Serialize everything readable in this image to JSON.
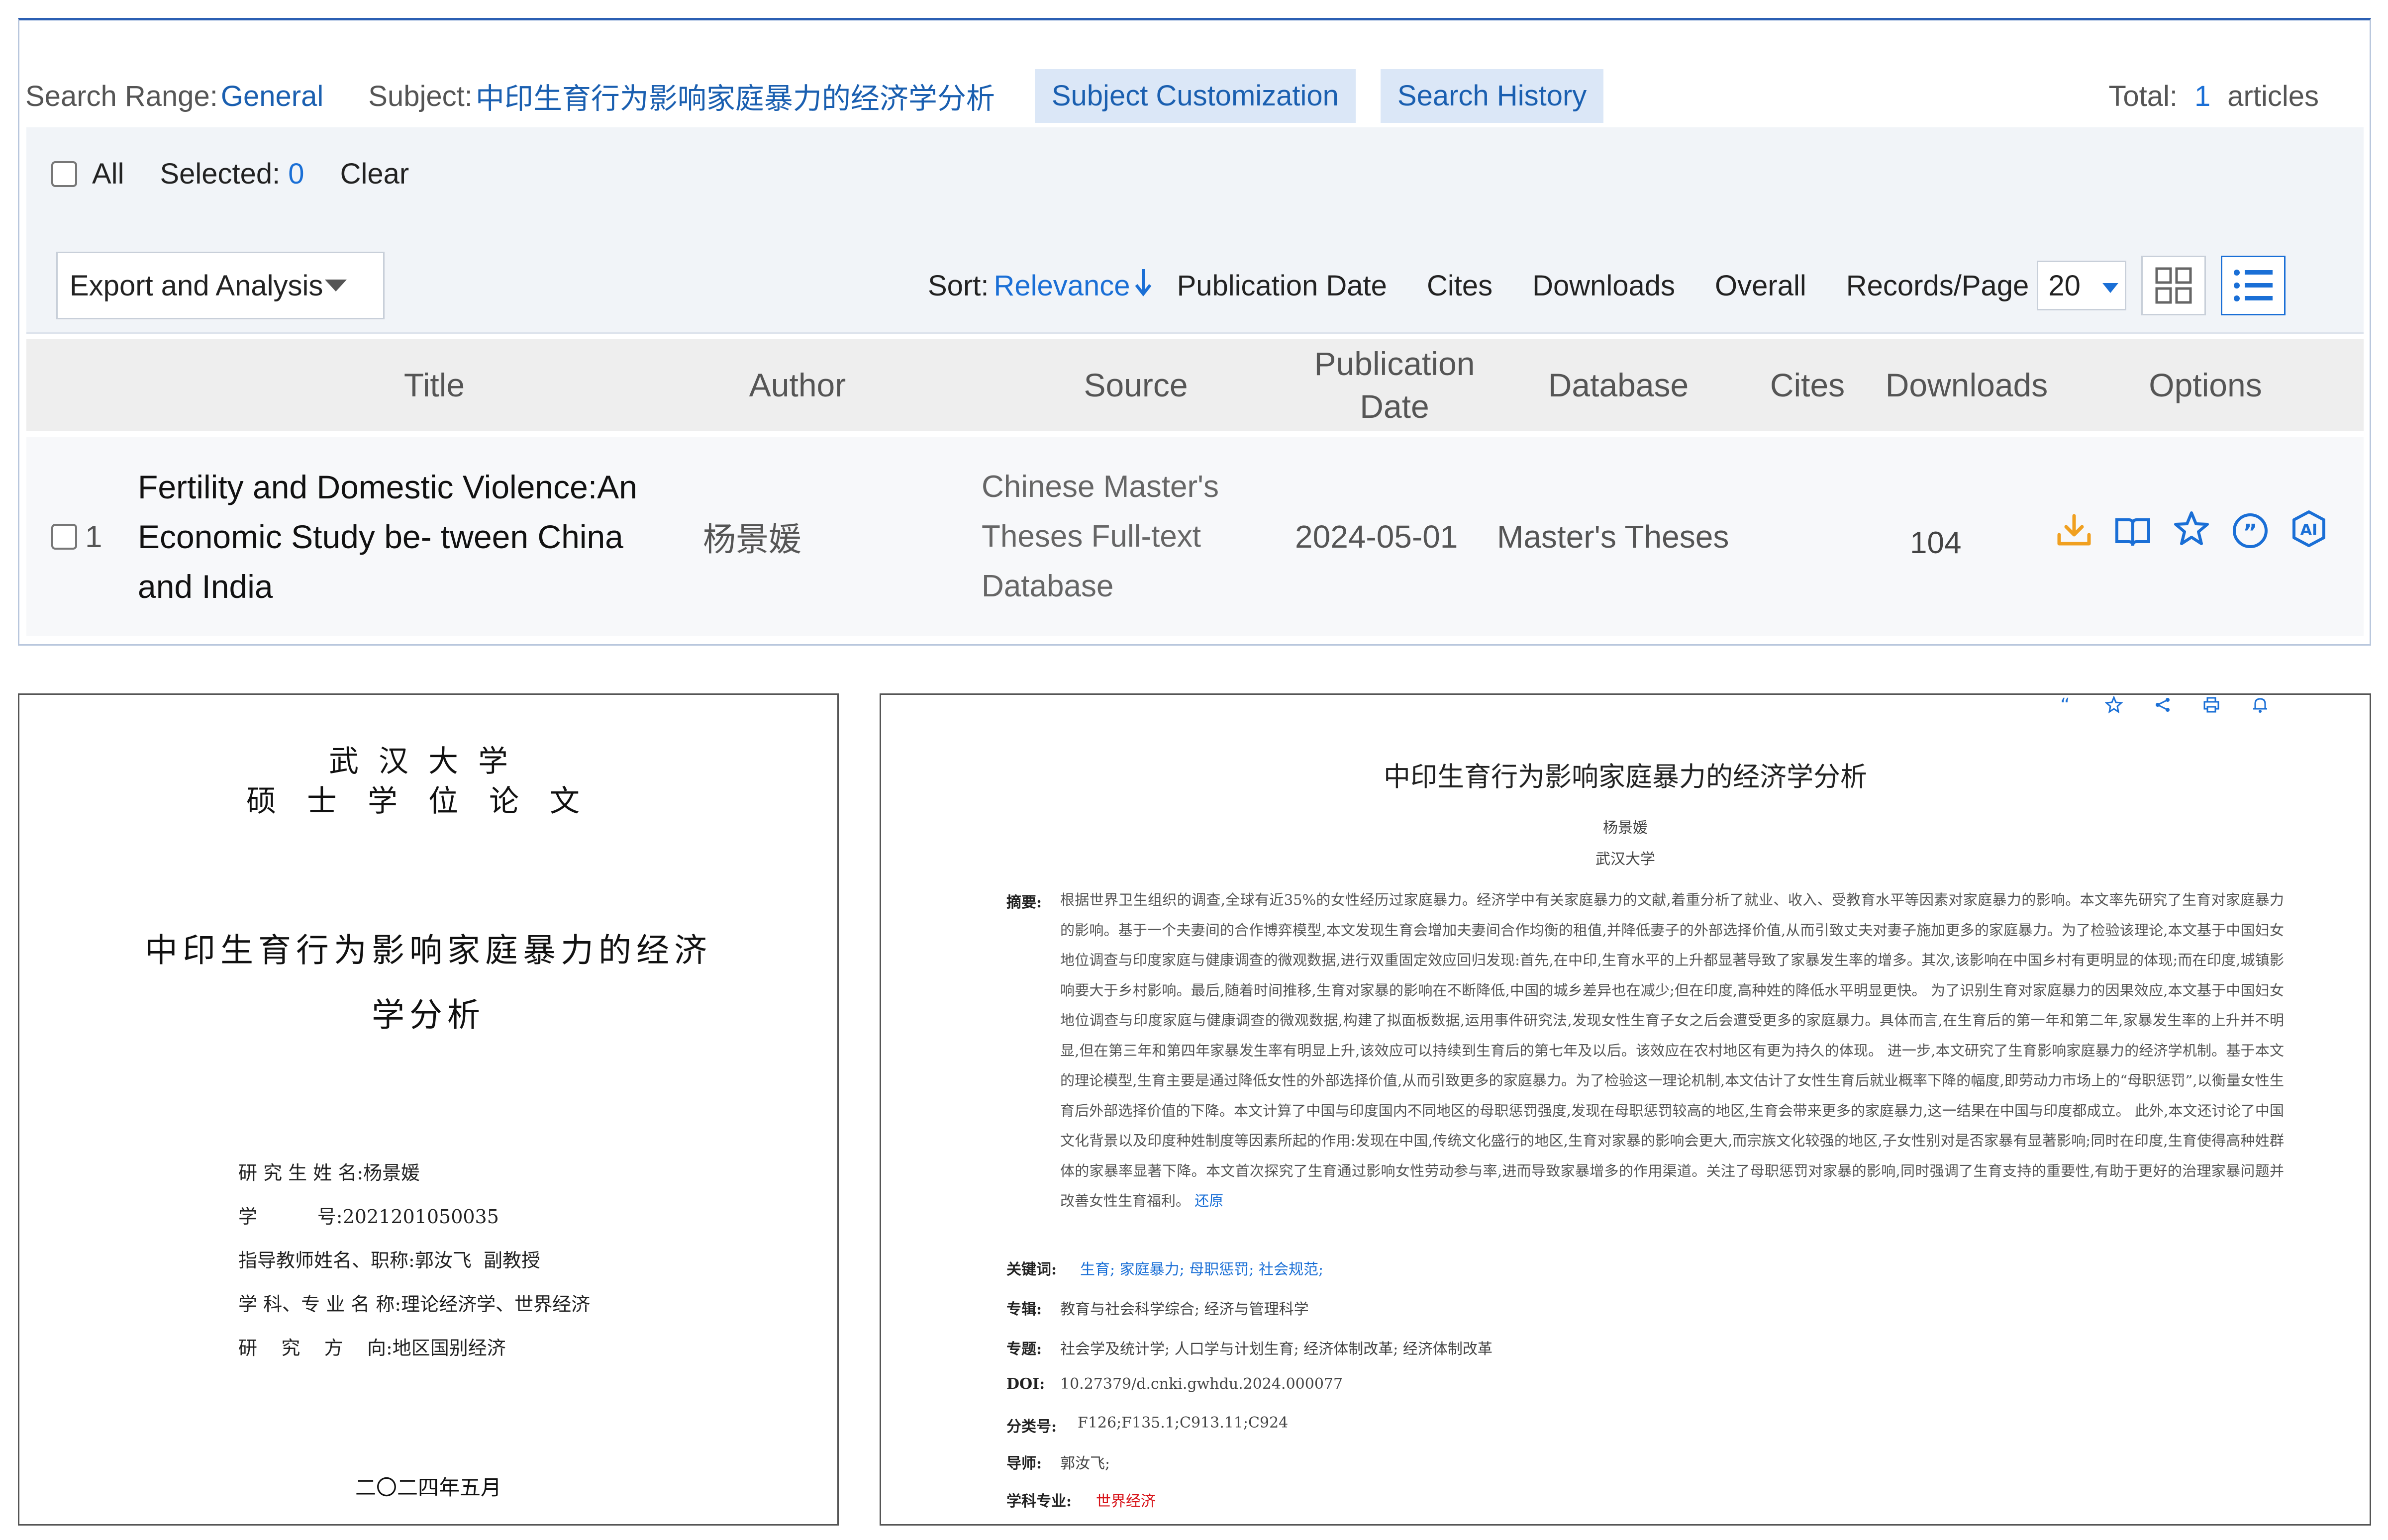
{
  "search_bar": {
    "range_label": "Search Range:",
    "range_value": "General",
    "subject_label": "Subject:",
    "subject_value": "中印生育行为影响家庭暴力的经济学分析",
    "subject_customization": "Subject Customization",
    "search_history": "Search History",
    "total_label": "Total:",
    "total_value": "1",
    "total_suffix": "articles"
  },
  "toolbar": {
    "all_label": "All",
    "selected_label": "Selected:",
    "selected_value": "0",
    "clear_label": "Clear",
    "export_label": "Export and Analysis",
    "sort_label": "Sort:",
    "sort_active": "Relevance",
    "sort_options": [
      "Publication Date",
      "Cites",
      "Downloads",
      "Overall"
    ],
    "records_label": "Records/Page",
    "records_value": "20"
  },
  "table": {
    "headers": [
      "Title",
      "Author",
      "Source",
      "Publication Date",
      "Database",
      "Cites",
      "Downloads",
      "Options"
    ],
    "rows": [
      {
        "index": "1",
        "title": "Fertility and Domestic Violence:An Economic Study be- tween China and India",
        "author": "杨景媛",
        "source": "Chinese Master's Theses Full-text Database",
        "date": "2024-05-01",
        "database": "Master's Theses",
        "cites": "",
        "downloads": "104"
      }
    ],
    "option_icons": [
      "download-icon",
      "read-book-icon",
      "favorite-star-icon",
      "quote-icon",
      "ai-icon"
    ]
  },
  "cover": {
    "university": "武汉大学",
    "degree": "硕士学位论文",
    "title_line1": "中印生育行为影响家庭暴力的经济",
    "title_line2": "学分析",
    "fields": [
      {
        "key": "研 究 生 姓 名:",
        "value": "杨景媛"
      },
      {
        "key": "学          号:",
        "value": "2021201050035"
      },
      {
        "key": "指导教师姓名、职称:",
        "value": "郭汝飞  副教授"
      },
      {
        "key": "学 科、专 业 名 称:",
        "value": "理论经济学、世界经济"
      },
      {
        "key": "研    究    方    向:",
        "value": "地区国别经济"
      }
    ],
    "date": "二〇二四年五月"
  },
  "abstract_page": {
    "title": "中印生育行为影响家庭暴力的经济学分析",
    "author": "杨景媛",
    "organization": "武汉大学",
    "abstract_label": "摘要:",
    "abstract_text": "根据世界卫生组织的调查,全球有近35%的女性经历过家庭暴力。经济学中有关家庭暴力的文献,着重分析了就业、收入、受教育水平等因素对家庭暴力的影响。本文率先研究了生育对家庭暴力的影响。基于一个夫妻间的合作博弈模型,本文发现生育会增加夫妻间合作均衡的租值,并降低妻子的外部选择价值,从而引致丈夫对妻子施加更多的家庭暴力。为了检验该理论,本文基于中国妇女地位调查与印度家庭与健康调查的微观数据,进行双重固定效应回归发现:首先,在中印,生育水平的上升都显著导致了家暴发生率的增多。其次,该影响在中国乡村有更明显的体现;而在印度,城镇影响要大于乡村影响。最后,随着时间推移,生育对家暴的影响在不断降低,中国的城乡差异也在减少;但在印度,高种姓的降低水平明显更快。 为了识别生育对家庭暴力的因果效应,本文基于中国妇女地位调查与印度家庭与健康调查的微观数据,构建了拟面板数据,运用事件研究法,发现女性生育子女之后会遭受更多的家庭暴力。具体而言,在生育后的第一年和第二年,家暴发生率的上升并不明显,但在第三年和第四年家暴发生率有明显上升,该效应可以持续到生育后的第七年及以后。该效应在农村地区有更为持久的体现。 进一步,本文研究了生育影响家庭暴力的经济学机制。基于本文的理论模型,生育主要是通过降低女性的外部选择价值,从而引致更多的家庭暴力。为了检验这一理论机制,本文估计了女性生育后就业概率下降的幅度,即劳动力市场上的“母职惩罚”,以衡量女性生育后外部选择价值的下降。本文计算了中国与印度国内不同地区的母职惩罚强度,发现在母职惩罚较高的地区,生育会带来更多的家庭暴力,这一结果在中国与印度都成立。 此外,本文还讨论了中国文化背景以及印度种姓制度等因素所起的作用:发现在中国,传统文化盛行的地区,生育对家暴的影响会更大,而宗族文化较强的地区,子女性别对是否家暴有显著影响;同时在印度,生育使得高种姓群体的家暴率显著下降。本文首次探究了生育通过影响女性劳动参与率,进而导致家暴增多的作用渠道。关注了母职惩罚对家暴的影响,同时强调了生育支持的重要性,有助于更好的治理家暴问题并改善女性生育福利。",
    "restore_link": "还原",
    "keywords_label": "关键词:",
    "keywords": [
      "生育;",
      "家庭暴力;",
      "母职惩罚;",
      "社会规范;"
    ],
    "series_label": "专辑:",
    "series_value": "教育与社会科学综合; 经济与管理科学",
    "topic_label": "专题:",
    "topic_value": "社会学及统计学; 人口学与计划生育; 经济体制改革; 经济体制改革",
    "doi_label": "DOI:",
    "doi_value": "10.27379/d.cnki.gwhdu.2024.000077",
    "class_label": "分类号:",
    "class_value": "F126;F135.1;C913.11;C924",
    "advisor_label": "导师:",
    "advisor_value": "郭汝飞;",
    "major_label": "学科专业:",
    "major_value": "世界经济"
  },
  "colors": {
    "accent": "#1a6fd6",
    "header_bg": "#eeeeee",
    "pill_bg": "#dbe7f7",
    "download_icon": "#f0a020",
    "red_text": "#d8151b"
  }
}
